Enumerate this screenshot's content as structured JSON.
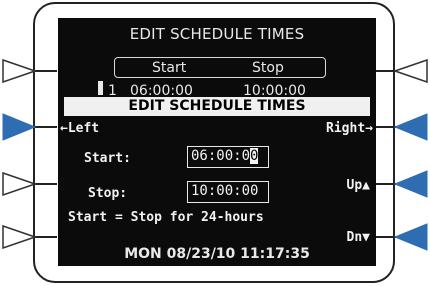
{
  "background": {
    "title": "EDIT SCHEDULE TIMES",
    "header_start": "Start",
    "header_stop": "Stop",
    "row_index": "1",
    "row_start": "06:00:00",
    "row_stop": "10:00:00"
  },
  "dialog": {
    "title": "EDIT SCHEDULE TIMES",
    "left_label": "←Left",
    "right_label": "Right→",
    "start_label": "Start:",
    "start_value_main": "06:00:0",
    "start_value_cursor": "0",
    "stop_label": "Stop:",
    "stop_value": "10:00:00",
    "up_label": "Up▲",
    "down_label": "Dn▼",
    "hint": "Start = Stop for 24-hours"
  },
  "status_bar": {
    "datetime": "MON 08/23/10 11:17:35"
  },
  "colors": {
    "active_button": "#2f6db3",
    "inactive_button": "#ffffff",
    "screen": "#0b0b0b"
  },
  "icons": {
    "left_softkeys": [
      "softkey-1-icon",
      "softkey-2-icon",
      "softkey-3-icon",
      "softkey-4-icon"
    ],
    "right_softkeys": [
      "softkey-5-icon",
      "softkey-6-icon",
      "softkey-7-icon",
      "softkey-8-icon"
    ]
  }
}
